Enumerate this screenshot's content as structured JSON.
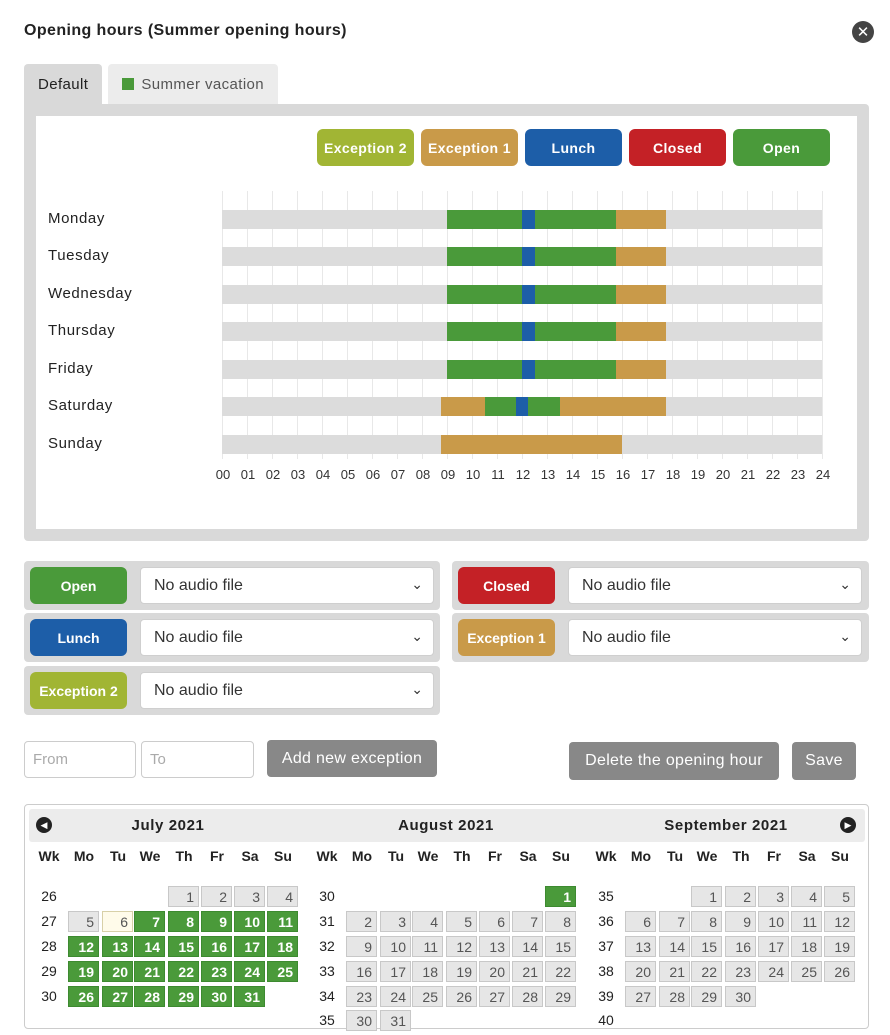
{
  "title": "Opening hours (Summer opening hours)",
  "tabs": [
    {
      "label": "Default",
      "active": true
    },
    {
      "label": "Summer vacation",
      "active": false,
      "color": "#4a9a3a"
    }
  ],
  "legend": [
    {
      "key": "exception2",
      "label": "Exception 2",
      "color": "#a1b534"
    },
    {
      "key": "exception1",
      "label": "Exception 1",
      "color": "#c99a49"
    },
    {
      "key": "lunch",
      "label": "Lunch",
      "color": "#1d5ea8"
    },
    {
      "key": "closed",
      "label": "Closed",
      "color": "#c42126"
    },
    {
      "key": "open",
      "label": "Open",
      "color": "#4a9a3a"
    }
  ],
  "schedule": {
    "hours": [
      "00",
      "01",
      "02",
      "03",
      "04",
      "05",
      "06",
      "07",
      "08",
      "09",
      "10",
      "11",
      "12",
      "13",
      "14",
      "15",
      "16",
      "17",
      "18",
      "19",
      "20",
      "21",
      "22",
      "23",
      "24"
    ],
    "days": [
      {
        "name": "Monday",
        "segments": [
          {
            "type": "open",
            "start": 9,
            "end": 12
          },
          {
            "type": "lunch",
            "start": 12,
            "end": 12.5
          },
          {
            "type": "open",
            "start": 12.5,
            "end": 15.75
          },
          {
            "type": "exception1",
            "start": 15.75,
            "end": 17.75
          }
        ]
      },
      {
        "name": "Tuesday",
        "segments": [
          {
            "type": "open",
            "start": 9,
            "end": 12
          },
          {
            "type": "lunch",
            "start": 12,
            "end": 12.5
          },
          {
            "type": "open",
            "start": 12.5,
            "end": 15.75
          },
          {
            "type": "exception1",
            "start": 15.75,
            "end": 17.75
          }
        ]
      },
      {
        "name": "Wednesday",
        "segments": [
          {
            "type": "open",
            "start": 9,
            "end": 12
          },
          {
            "type": "lunch",
            "start": 12,
            "end": 12.5
          },
          {
            "type": "open",
            "start": 12.5,
            "end": 15.75
          },
          {
            "type": "exception1",
            "start": 15.75,
            "end": 17.75
          }
        ]
      },
      {
        "name": "Thursday",
        "segments": [
          {
            "type": "open",
            "start": 9,
            "end": 12
          },
          {
            "type": "lunch",
            "start": 12,
            "end": 12.5
          },
          {
            "type": "open",
            "start": 12.5,
            "end": 15.75
          },
          {
            "type": "exception1",
            "start": 15.75,
            "end": 17.75
          }
        ]
      },
      {
        "name": "Friday",
        "segments": [
          {
            "type": "open",
            "start": 9,
            "end": 12
          },
          {
            "type": "lunch",
            "start": 12,
            "end": 12.5
          },
          {
            "type": "open",
            "start": 12.5,
            "end": 15.75
          },
          {
            "type": "exception1",
            "start": 15.75,
            "end": 17.75
          }
        ]
      },
      {
        "name": "Saturday",
        "segments": [
          {
            "type": "exception1",
            "start": 8.75,
            "end": 10.5
          },
          {
            "type": "open",
            "start": 10.5,
            "end": 11.75
          },
          {
            "type": "lunch",
            "start": 11.75,
            "end": 12.25
          },
          {
            "type": "open",
            "start": 12.25,
            "end": 13.5
          },
          {
            "type": "exception1",
            "start": 13.5,
            "end": 17.75
          }
        ]
      },
      {
        "name": "Sunday",
        "segments": [
          {
            "type": "exception1",
            "start": 8.75,
            "end": 16
          }
        ]
      }
    ]
  },
  "audio": [
    {
      "label": "Open",
      "color": "#4a9a3a",
      "value": "No audio file"
    },
    {
      "label": "Closed",
      "color": "#c42126",
      "value": "No audio file"
    },
    {
      "label": "Lunch",
      "color": "#1d5ea8",
      "value": "No audio file"
    },
    {
      "label": "Exception 1",
      "color": "#c99a49",
      "value": "No audio file"
    },
    {
      "label": "Exception 2",
      "color": "#a1b534",
      "value": "No audio file"
    }
  ],
  "exception_form": {
    "from_placeholder": "From",
    "to_placeholder": "To",
    "add_label": "Add new exception",
    "delete_label": "Delete the opening hour",
    "save_label": "Save"
  },
  "calendar": {
    "headers": [
      "Wk",
      "Mo",
      "Tu",
      "We",
      "Th",
      "Fr",
      "Sa",
      "Su"
    ],
    "months": [
      {
        "title": "July 2021",
        "weeks": [
          {
            "wk": "26",
            "days": [
              null,
              null,
              null,
              {
                "d": "1",
                "s": "grey"
              },
              {
                "d": "2",
                "s": "grey"
              },
              {
                "d": "3",
                "s": "grey"
              },
              {
                "d": "4",
                "s": "grey"
              }
            ]
          },
          {
            "wk": "27",
            "days": [
              {
                "d": "5",
                "s": "grey"
              },
              {
                "d": "6",
                "s": "today"
              },
              {
                "d": "7",
                "s": "green"
              },
              {
                "d": "8",
                "s": "green"
              },
              {
                "d": "9",
                "s": "green"
              },
              {
                "d": "10",
                "s": "green"
              },
              {
                "d": "11",
                "s": "green"
              }
            ]
          },
          {
            "wk": "28",
            "days": [
              {
                "d": "12",
                "s": "green"
              },
              {
                "d": "13",
                "s": "green"
              },
              {
                "d": "14",
                "s": "green"
              },
              {
                "d": "15",
                "s": "green"
              },
              {
                "d": "16",
                "s": "green"
              },
              {
                "d": "17",
                "s": "green"
              },
              {
                "d": "18",
                "s": "green"
              }
            ]
          },
          {
            "wk": "29",
            "days": [
              {
                "d": "19",
                "s": "green"
              },
              {
                "d": "20",
                "s": "green"
              },
              {
                "d": "21",
                "s": "green"
              },
              {
                "d": "22",
                "s": "green"
              },
              {
                "d": "23",
                "s": "green"
              },
              {
                "d": "24",
                "s": "green"
              },
              {
                "d": "25",
                "s": "green"
              }
            ]
          },
          {
            "wk": "30",
            "days": [
              {
                "d": "26",
                "s": "green"
              },
              {
                "d": "27",
                "s": "green"
              },
              {
                "d": "28",
                "s": "green"
              },
              {
                "d": "29",
                "s": "green"
              },
              {
                "d": "30",
                "s": "green"
              },
              {
                "d": "31",
                "s": "green"
              },
              null
            ]
          }
        ]
      },
      {
        "title": "August 2021",
        "weeks": [
          {
            "wk": "30",
            "days": [
              null,
              null,
              null,
              null,
              null,
              null,
              {
                "d": "1",
                "s": "green"
              }
            ]
          },
          {
            "wk": "31",
            "days": [
              {
                "d": "2",
                "s": "grey"
              },
              {
                "d": "3",
                "s": "grey"
              },
              {
                "d": "4",
                "s": "grey"
              },
              {
                "d": "5",
                "s": "grey"
              },
              {
                "d": "6",
                "s": "grey"
              },
              {
                "d": "7",
                "s": "grey"
              },
              {
                "d": "8",
                "s": "grey"
              }
            ]
          },
          {
            "wk": "32",
            "days": [
              {
                "d": "9",
                "s": "grey"
              },
              {
                "d": "10",
                "s": "grey"
              },
              {
                "d": "11",
                "s": "grey"
              },
              {
                "d": "12",
                "s": "grey"
              },
              {
                "d": "13",
                "s": "grey"
              },
              {
                "d": "14",
                "s": "grey"
              },
              {
                "d": "15",
                "s": "grey"
              }
            ]
          },
          {
            "wk": "33",
            "days": [
              {
                "d": "16",
                "s": "grey"
              },
              {
                "d": "17",
                "s": "grey"
              },
              {
                "d": "18",
                "s": "grey"
              },
              {
                "d": "19",
                "s": "grey"
              },
              {
                "d": "20",
                "s": "grey"
              },
              {
                "d": "21",
                "s": "grey"
              },
              {
                "d": "22",
                "s": "grey"
              }
            ]
          },
          {
            "wk": "34",
            "days": [
              {
                "d": "23",
                "s": "grey"
              },
              {
                "d": "24",
                "s": "grey"
              },
              {
                "d": "25",
                "s": "grey"
              },
              {
                "d": "26",
                "s": "grey"
              },
              {
                "d": "27",
                "s": "grey"
              },
              {
                "d": "28",
                "s": "grey"
              },
              {
                "d": "29",
                "s": "grey"
              }
            ]
          },
          {
            "wk": "35",
            "days": [
              {
                "d": "30",
                "s": "grey"
              },
              {
                "d": "31",
                "s": "grey"
              },
              null,
              null,
              null,
              null,
              null
            ]
          }
        ]
      },
      {
        "title": "September 2021",
        "weeks": [
          {
            "wk": "35",
            "days": [
              null,
              null,
              {
                "d": "1",
                "s": "grey"
              },
              {
                "d": "2",
                "s": "grey"
              },
              {
                "d": "3",
                "s": "grey"
              },
              {
                "d": "4",
                "s": "grey"
              },
              {
                "d": "5",
                "s": "grey"
              }
            ]
          },
          {
            "wk": "36",
            "days": [
              {
                "d": "6",
                "s": "grey"
              },
              {
                "d": "7",
                "s": "grey"
              },
              {
                "d": "8",
                "s": "grey"
              },
              {
                "d": "9",
                "s": "grey"
              },
              {
                "d": "10",
                "s": "grey"
              },
              {
                "d": "11",
                "s": "grey"
              },
              {
                "d": "12",
                "s": "grey"
              }
            ]
          },
          {
            "wk": "37",
            "days": [
              {
                "d": "13",
                "s": "grey"
              },
              {
                "d": "14",
                "s": "grey"
              },
              {
                "d": "15",
                "s": "grey"
              },
              {
                "d": "16",
                "s": "grey"
              },
              {
                "d": "17",
                "s": "grey"
              },
              {
                "d": "18",
                "s": "grey"
              },
              {
                "d": "19",
                "s": "grey"
              }
            ]
          },
          {
            "wk": "38",
            "days": [
              {
                "d": "20",
                "s": "grey"
              },
              {
                "d": "21",
                "s": "grey"
              },
              {
                "d": "22",
                "s": "grey"
              },
              {
                "d": "23",
                "s": "grey"
              },
              {
                "d": "24",
                "s": "grey"
              },
              {
                "d": "25",
                "s": "grey"
              },
              {
                "d": "26",
                "s": "grey"
              }
            ]
          },
          {
            "wk": "39",
            "days": [
              {
                "d": "27",
                "s": "grey"
              },
              {
                "d": "28",
                "s": "grey"
              },
              {
                "d": "29",
                "s": "grey"
              },
              {
                "d": "30",
                "s": "grey"
              },
              null,
              null,
              null
            ]
          },
          {
            "wk": "40",
            "days": [
              null,
              null,
              null,
              null,
              null,
              null,
              null
            ]
          }
        ]
      }
    ]
  }
}
